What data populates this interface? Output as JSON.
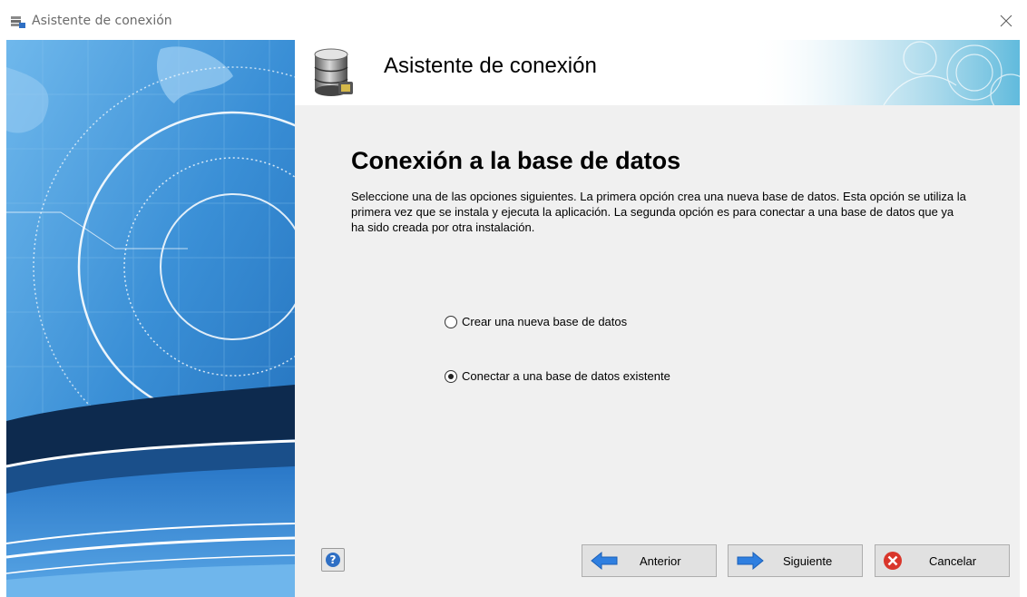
{
  "window": {
    "title": "Asistente de conexión",
    "close_icon": "close-icon"
  },
  "header": {
    "title": "Asistente de conexión",
    "icon": "database-icon"
  },
  "main": {
    "section_title": "Conexión a la base de datos",
    "description": "Seleccione una de las opciones siguientes. La primera opción crea una nueva base de datos. Esta opción se utiliza la primera vez que se instala y ejecuta la aplicación. La segunda opción es para conectar a una base de datos que ya ha sido creada por otra instalación.",
    "options": [
      {
        "label": "Crear una nueva base de datos",
        "selected": false
      },
      {
        "label": "Conectar a una base de datos existente",
        "selected": true
      }
    ]
  },
  "footer": {
    "help_icon": "help-icon",
    "back_label": "Anterior",
    "next_label": "Siguiente",
    "cancel_label": "Cancelar"
  },
  "colors": {
    "banner_blue": "#3a8fd6",
    "banner_dark": "#0d2a4e",
    "arrow_blue": "#2f7fe0",
    "cancel_red": "#d9362b",
    "content_bg": "#f0f0f0"
  }
}
